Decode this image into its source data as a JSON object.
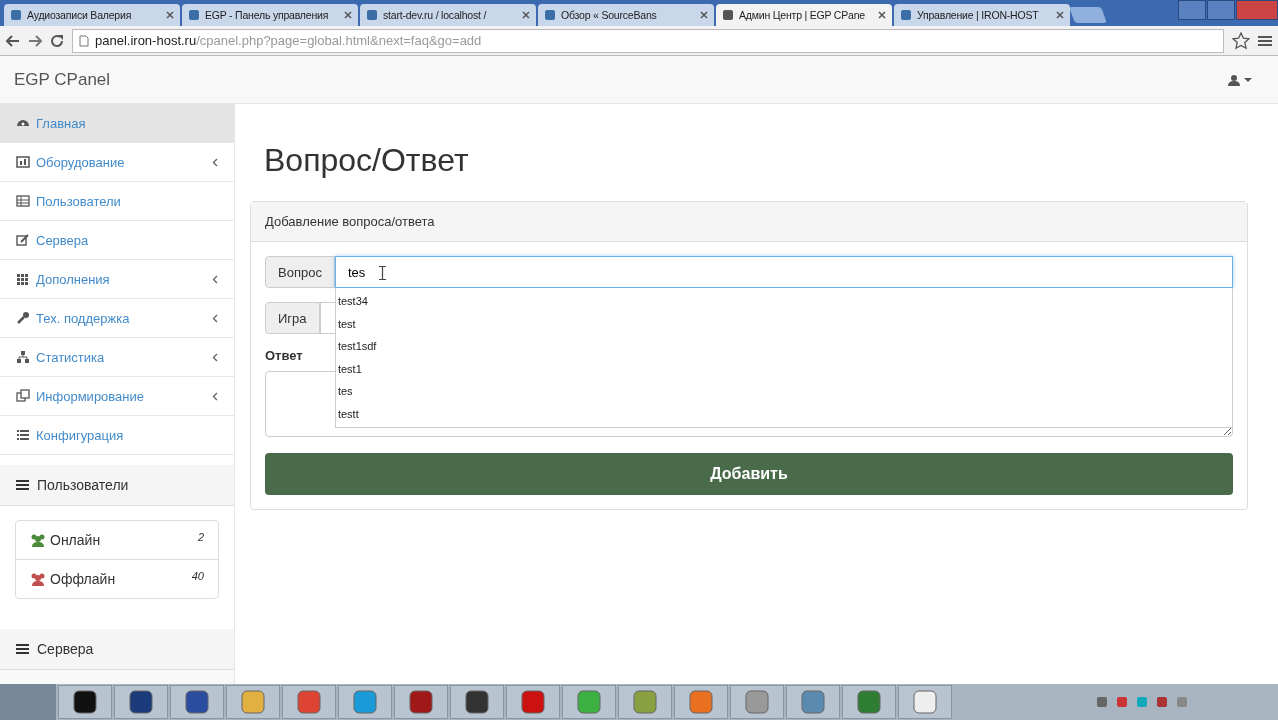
{
  "browser": {
    "tabs": [
      {
        "title": "Аудиозаписи Валерия",
        "selected": false
      },
      {
        "title": "EGP - Панель управления",
        "selected": false
      },
      {
        "title": "start-dev.ru / localhost /",
        "selected": false
      },
      {
        "title": "Обзор « SourceBans",
        "selected": false
      },
      {
        "title": "Админ Центр | EGP CPane",
        "selected": true
      },
      {
        "title": "Управление | IRON-HOST",
        "selected": false
      }
    ],
    "address": {
      "host": "panel.iron-host.ru",
      "path": "/cpanel.php?page=global.html&next=faq&go=add"
    }
  },
  "navbar": {
    "brand": "EGP CPanel"
  },
  "sidebar": {
    "items": [
      {
        "label": "Главная",
        "selected": true,
        "has_submenu": false
      },
      {
        "label": "Оборудование",
        "selected": false,
        "has_submenu": true
      },
      {
        "label": "Пользователи",
        "selected": false,
        "has_submenu": false
      },
      {
        "label": "Сервера",
        "selected": false,
        "has_submenu": false
      },
      {
        "label": "Дополнения",
        "selected": false,
        "has_submenu": true
      },
      {
        "label": "Тех. поддержка",
        "selected": false,
        "has_submenu": true
      },
      {
        "label": "Статистика",
        "selected": false,
        "has_submenu": true
      },
      {
        "label": "Информирование",
        "selected": false,
        "has_submenu": true
      },
      {
        "label": "Конфигурация",
        "selected": false,
        "has_submenu": false
      }
    ],
    "users_panel": {
      "title": "Пользователи",
      "rows": [
        {
          "label": "Онлайн",
          "count": "2",
          "color": "#4a8a3a"
        },
        {
          "label": "Оффлайн",
          "count": "40",
          "color": "#c0504d"
        }
      ]
    },
    "servers_panel": {
      "title": "Сервера"
    }
  },
  "page": {
    "title": "Вопрос/Ответ",
    "panel_title": "Добавление вопроса/ответа",
    "question": {
      "label": "Вопрос",
      "value": "tes"
    },
    "game": {
      "label": "Игра"
    },
    "suggestions": [
      "test34",
      "test",
      "test1sdf",
      "test1",
      "tes",
      "testt"
    ],
    "answer": {
      "label": "Ответ"
    },
    "submit": "Добавить"
  }
}
